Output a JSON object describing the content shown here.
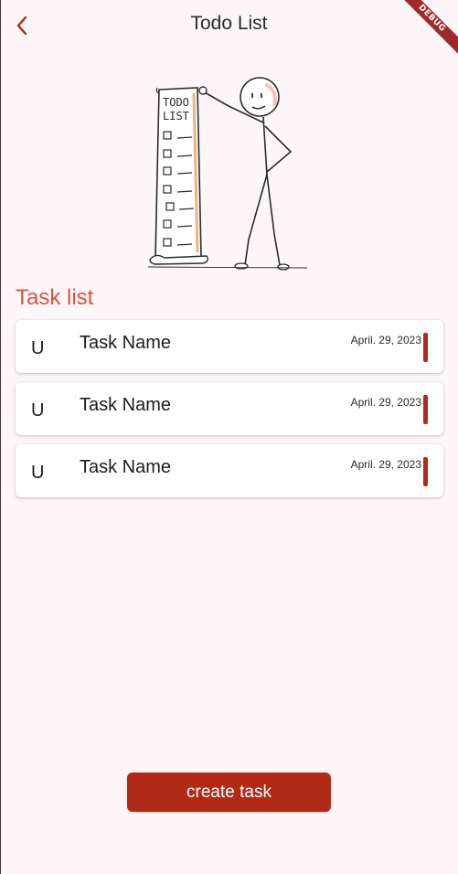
{
  "app_bar": {
    "title": "Todo List",
    "back_icon": "chevron-left-icon",
    "debug_label": "DEBUG"
  },
  "colors": {
    "accent": "#b02a17",
    "section_title": "#e0523e",
    "status_bar": "#b5281a",
    "background": "#fdf7fa"
  },
  "illustration": {
    "icon": "todo-list-stickman-illustration"
  },
  "section": {
    "title": "Task list"
  },
  "tasks": [
    {
      "avatar": "U",
      "name": "Task Name",
      "date": "April. 29, 2023"
    },
    {
      "avatar": "U",
      "name": "Task Name",
      "date": "April. 29, 2023"
    },
    {
      "avatar": "U",
      "name": "Task Name",
      "date": "April. 29, 2023"
    }
  ],
  "actions": {
    "create_label": "create task"
  }
}
